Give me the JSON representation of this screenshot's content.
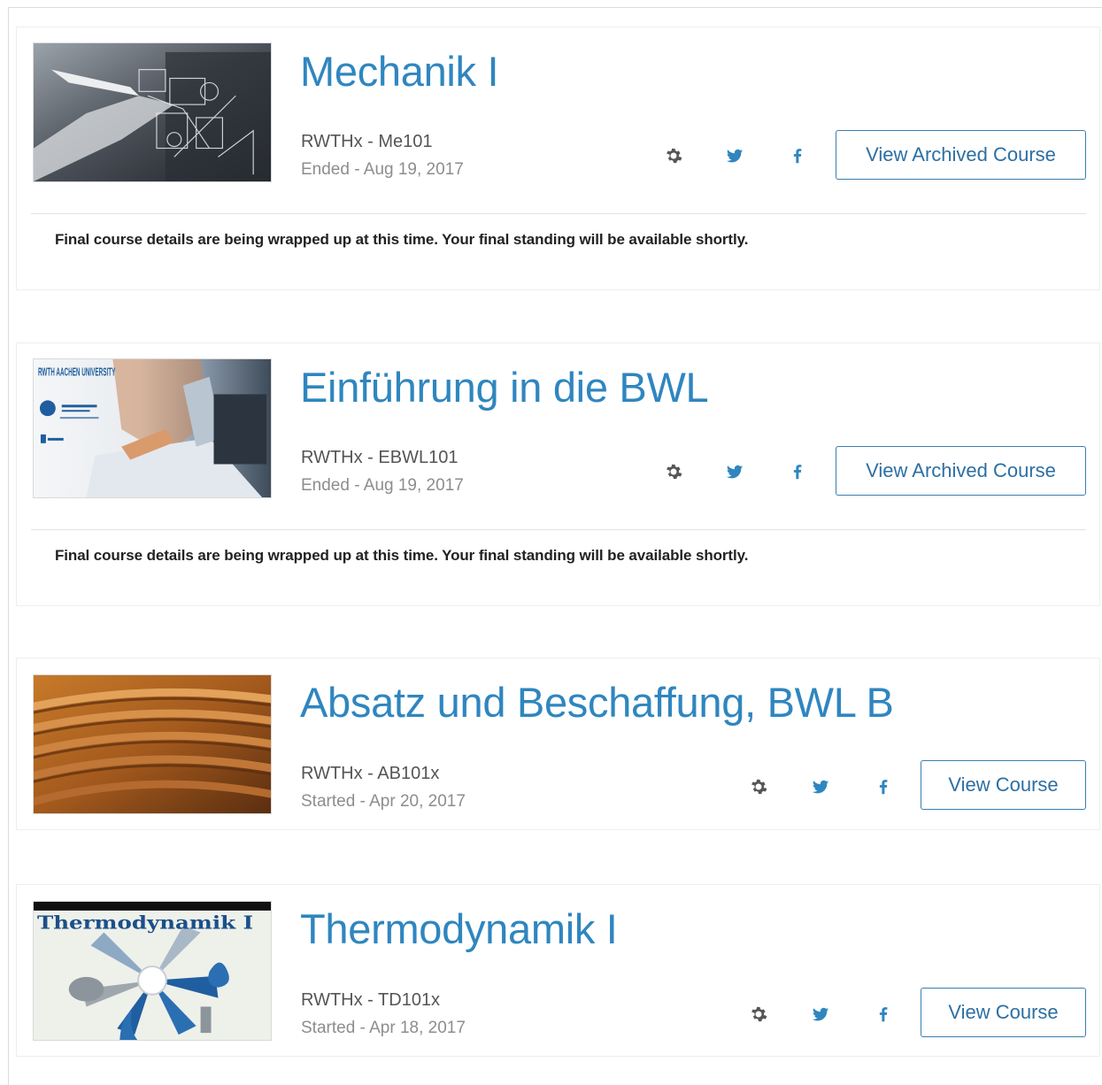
{
  "courses": [
    {
      "title": "Mechanik I",
      "code": "RWTHx - Me101",
      "date": "Ended - Aug 19, 2017",
      "button_label": "View Archived Course",
      "note": "Final course details are being wrapped up at this time. Your final standing will be available shortly."
    },
    {
      "title": "Einführung in die BWL",
      "code": "RWTHx - EBWL101",
      "date": "Ended - Aug 19, 2017",
      "button_label": "View Archived Course",
      "note": "Final course details are being wrapped up at this time. Your final standing will be available shortly.",
      "thumb_logo": "RWTH AACHEN UNIVERSITY"
    },
    {
      "title": "Absatz und Beschaffung, BWL B",
      "code": "RWTHx - AB101x",
      "date": "Started - Apr 20, 2017",
      "button_label": "View Course"
    },
    {
      "title": "Thermodynamik I",
      "code": "RWTHx - TD101x",
      "date": "Started - Apr 18, 2017",
      "button_label": "View Course",
      "thumb_text": "Thermodynamik I"
    }
  ],
  "icons": {
    "settings": "gear-icon",
    "twitter": "twitter-icon",
    "facebook": "facebook-icon"
  },
  "colors": {
    "title": "#2f86bf",
    "button_border": "#3a7eb0",
    "social_icon": "#2f86bf",
    "settings_icon": "#555555"
  }
}
